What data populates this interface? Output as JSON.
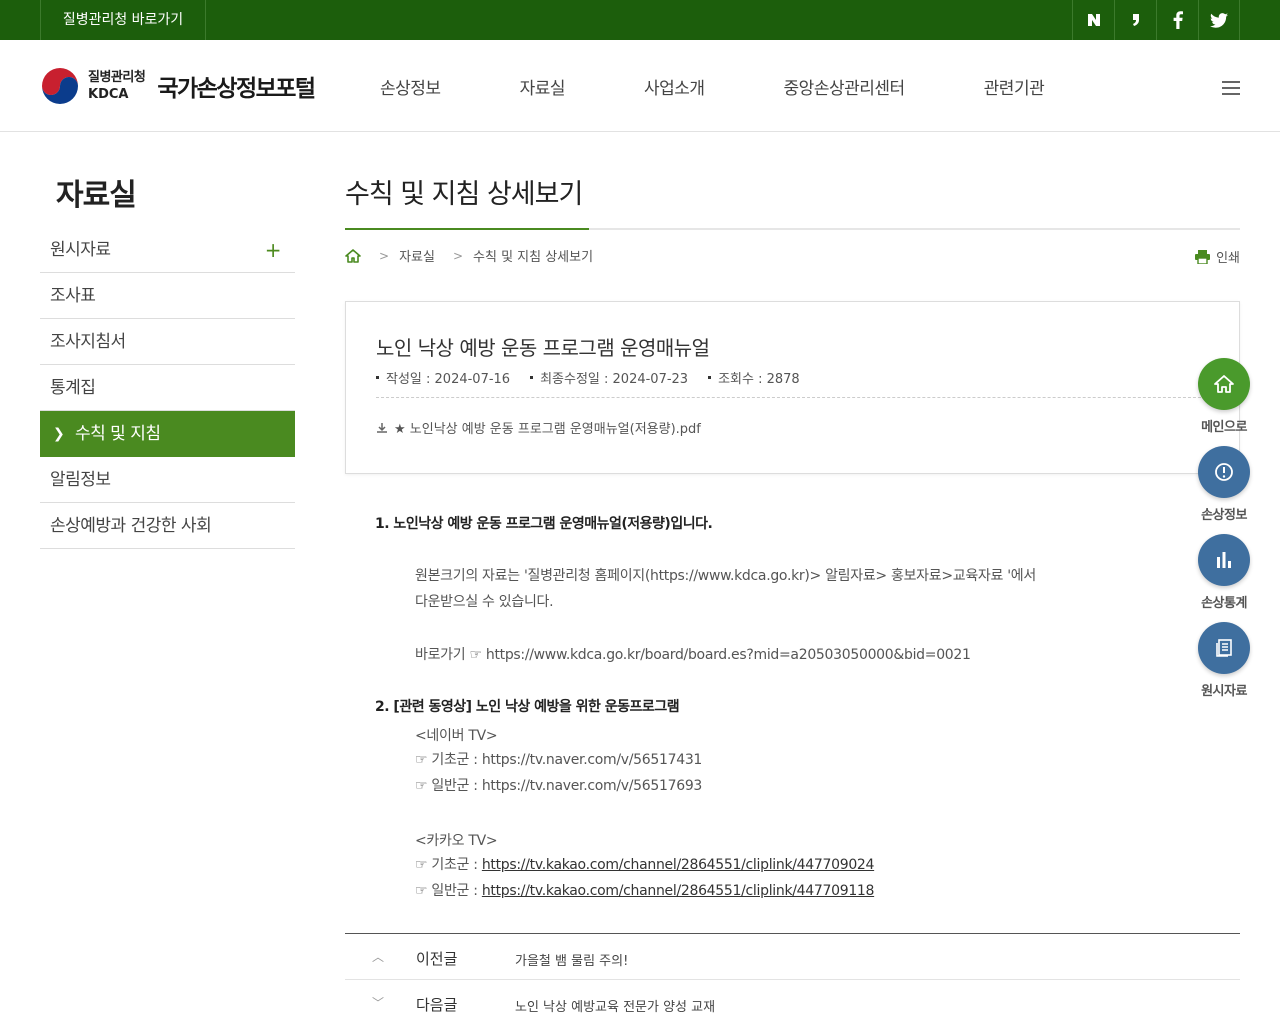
{
  "topbar": {
    "shortcut_label": "질병관리청 바로가기",
    "sns": [
      {
        "name": "naver-blog-icon",
        "glyph": "N"
      },
      {
        "name": "kakao-icon",
        "glyph": "❜"
      },
      {
        "name": "facebook-icon",
        "glyph": "f"
      },
      {
        "name": "twitter-icon",
        "glyph": "🐦"
      }
    ]
  },
  "header": {
    "org_ko": "질병관리청",
    "org_en": "KDCA",
    "portal_name": "국가손상정보포털",
    "gnb": [
      "손상정보",
      "자료실",
      "사업소개",
      "중앙손상관리센터",
      "관련기관"
    ]
  },
  "sidebar": {
    "title": "자료실",
    "items": [
      {
        "label": "원시자료",
        "has_plus": true
      },
      {
        "label": "조사표"
      },
      {
        "label": "조사지침서"
      },
      {
        "label": "통계집"
      },
      {
        "label": "수칙 및 지침",
        "active": true
      },
      {
        "label": "알림정보"
      },
      {
        "label": "손상예방과 건강한 사회"
      }
    ]
  },
  "main": {
    "page_title": "수칙 및 지침 상세보기",
    "breadcrumb": [
      "자료실",
      "수칙 및 지침 상세보기"
    ],
    "print_label": "인쇄",
    "post": {
      "title": "노인 낙상 예방 운동 프로그램 운영매뉴얼",
      "created": "작성일 : 2024-07-16",
      "modified": "최종수정일 : 2024-07-23",
      "views": "조회수 : 2878",
      "attachment": "★ 노인낙상 예방 운동 프로그램 운영매뉴얼(저용량).pdf"
    },
    "content": {
      "h1": "1. 노인낙상 예방 운동 프로그램 운영매뉴얼(저용량)입니다.",
      "p1_line1": "원본크기의 자료는 '질병관리청 홈페이지(https://www.kdca.go.kr)> 알림자료> 홍보자료>교육자료 '에서",
      "p1_line2": "다운받으실 수 있습니다.",
      "p2": "바로가기 ☞ https://www.kdca.go.kr/board/board.es?mid=a20503050000&bid=0021",
      "h2": "2. [관련 동영상] 노인 낙상 예방을 위한 운동프로그램",
      "naver_title": "<네이버 TV>",
      "naver_basic_prefix": "☞ 기초군 : ",
      "naver_basic_url": "https://tv.naver.com/v/56517431",
      "naver_general_prefix": "☞ 일반군 : ",
      "naver_general_url": "https://tv.naver.com/v/56517693",
      "kakao_title": "<카카오 TV>",
      "kakao_basic_prefix": "☞ 기초군 : ",
      "kakao_basic_url": "https://tv.kakao.com/channel/2864551/cliplink/447709024",
      "kakao_general_prefix": "☞ 일반군 : ",
      "kakao_general_url": "https://tv.kakao.com/channel/2864551/cliplink/447709118"
    },
    "prev": {
      "label": "이전글",
      "subject": "가을철 뱀 물림 주의!"
    },
    "next": {
      "label": "다음글",
      "subject": "노인 낙상 예방교육 전문가 양성 교재"
    }
  },
  "quick_menu": [
    {
      "label": "메인으로",
      "icon": "home-icon",
      "color": "#4a9a2c"
    },
    {
      "label": "손상정보",
      "icon": "alert-icon",
      "color": "#3f6f9f"
    },
    {
      "label": "손상통계",
      "icon": "bar-chart-icon",
      "color": "#3f6f9f"
    },
    {
      "label": "원시자료",
      "icon": "document-icon",
      "color": "#3f6f9f"
    }
  ]
}
